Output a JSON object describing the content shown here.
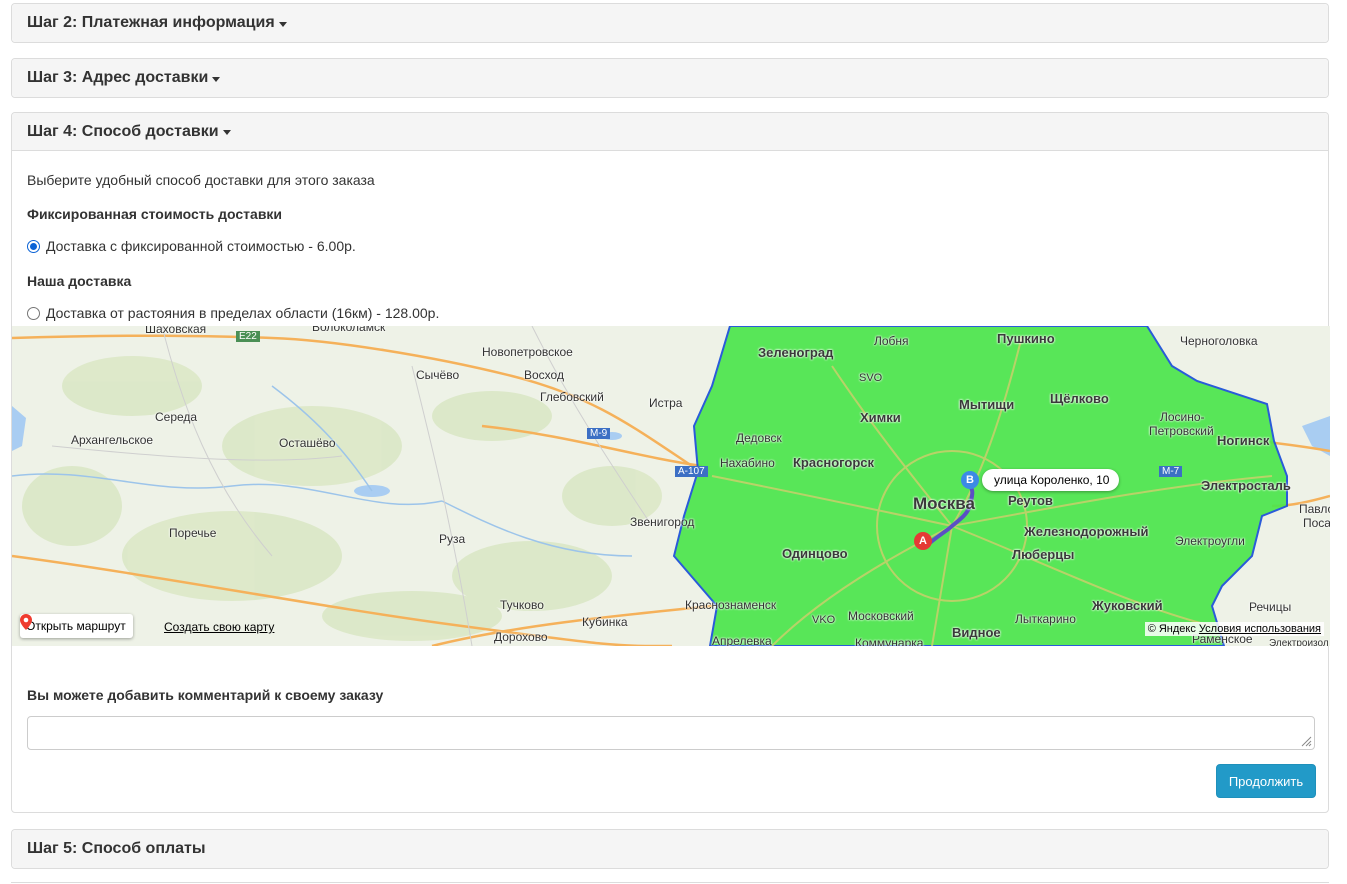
{
  "steps": {
    "step2_title": "Шаг 2: Платежная информация",
    "step3_title": "Шаг 3: Адрес доставки",
    "step4_title": "Шаг 4: Способ доставки",
    "step5_title": "Шаг 5: Способ оплаты"
  },
  "delivery": {
    "intro": "Выберите удобный способ доставки для этого заказа",
    "group1_title": "Фиксированная стоимость доставки",
    "option1_label": "Доставка с фиксированной стоимостью - 6.00р.",
    "option1_checked": true,
    "group2_title": "Наша доставка",
    "option2_label": "Доставка от растояния в пределах области (16км) - 128.00р.",
    "option2_checked": false
  },
  "map": {
    "open_route": "Открыть маршрут",
    "create_map": "Создать свою карту",
    "copyright_prefix": "© Яндекс",
    "terms": "Условия использования",
    "destination": "улица Короленко, 10",
    "marker_a": "A",
    "marker_b": "B",
    "zone_color": "#4ce64c",
    "zone_border_color": "#1a4fd8",
    "route_color": "#5b4fc4",
    "places": {
      "zelenograd": "Зеленоград",
      "lobnya": "Лобня",
      "pushkino": "Пушкино",
      "chernogolovka": "Черноголовка",
      "shakhovskaya": "Шаховская",
      "volokolamsk": "Волоколамск",
      "novopetrovskoe": "Новопетровское",
      "sychevo": "Сычёво",
      "voskhod": "Восход",
      "svo": "SVO",
      "khimki": "Химки",
      "mytishchi": "Мытищи",
      "shchelkovo": "Щёлково",
      "glebovsky": "Глебовский",
      "istra": "Истра",
      "sereda": "Середа",
      "losino": "Лосино-",
      "petrovsky": "Петровский",
      "arkhangelskoe": "Архангельское",
      "ostashevo": "Осташёво",
      "dedovsk": "Дедовск",
      "noginsk": "Ногинск",
      "nakhabino": "Нахабино",
      "krasnogorsk": "Красногорск",
      "elektrostal": "Электросталь",
      "moskva": "Москва",
      "reutov": "Реутов",
      "zvenigorod": "Звенигород",
      "pavlovo": "Павлово",
      "posad": "Посад",
      "porechye": "Поречье",
      "zheleznodorozhny": "Железнодорожный",
      "ruza": "Руза",
      "odintsovo": "Одинцово",
      "lyubertsy": "Люберцы",
      "elektrougli": "Электроугли",
      "tuchkovo": "Тучково",
      "krasnoznamensk": "Краснознаменск",
      "zhukovsky": "Жуковский",
      "rechitsy": "Речицы",
      "kubinka": "Кубинка",
      "vko": "VKO",
      "moskovsky": "Московский",
      "lytkarino": "Лыткарино",
      "dorokhovo": "Дорохово",
      "aprelevka": "Апрелевка",
      "kommunarka": "Коммунарка",
      "vidnoe": "Видное",
      "ramenskoe": "Раменское",
      "elektrouzli2": "Электроизол",
      "e22": "E22",
      "m9": "М-9",
      "a107": "А-107",
      "m7": "М-7"
    }
  },
  "comment": {
    "label": "Вы можете добавить комментарий к своему заказу",
    "value": ""
  },
  "buttons": {
    "continue": "Продолжить"
  }
}
